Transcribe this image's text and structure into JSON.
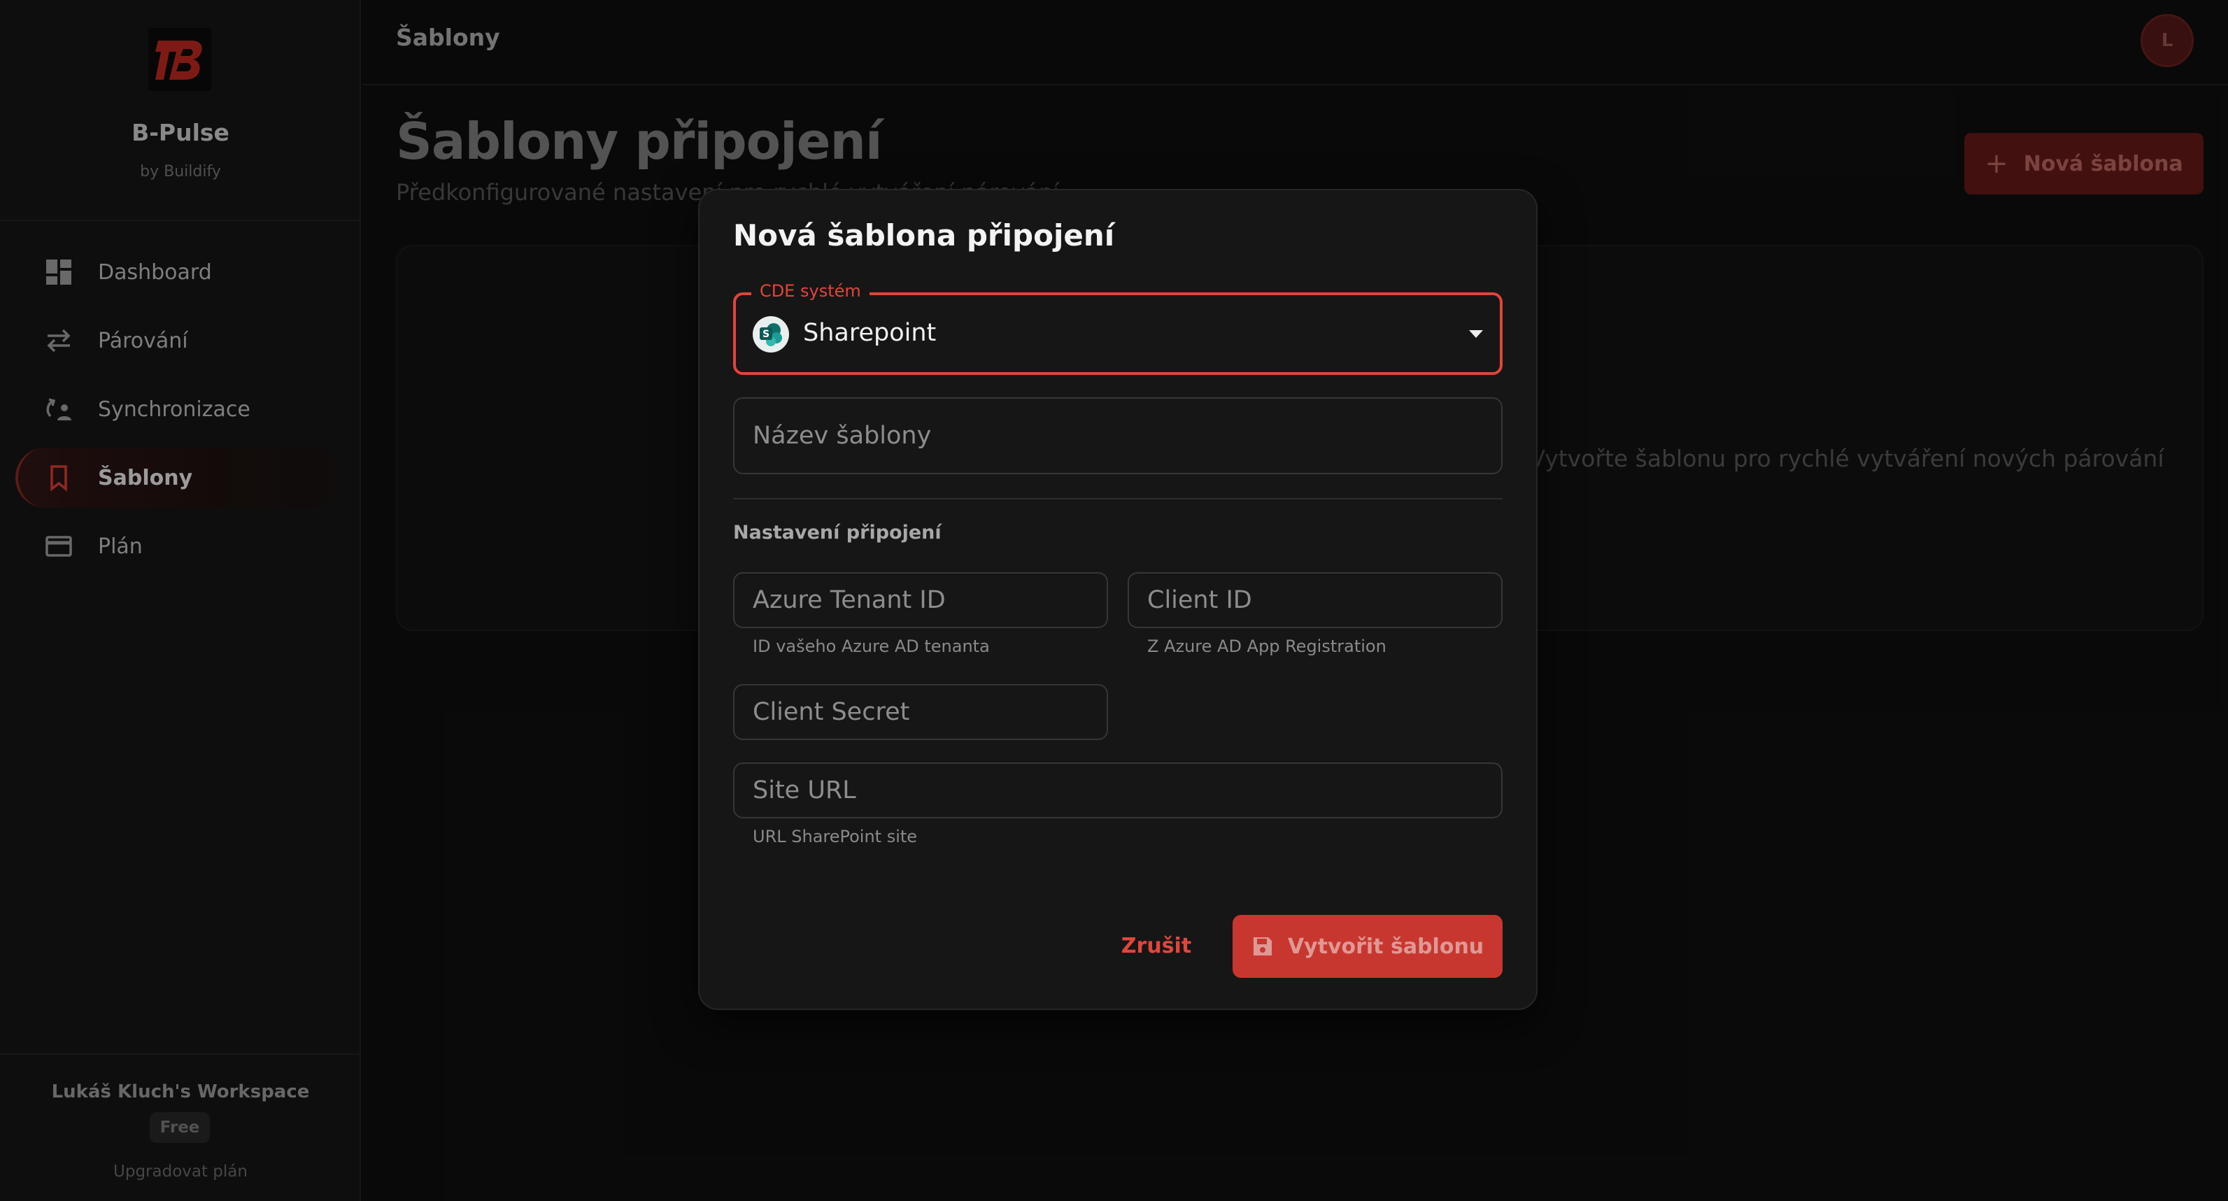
{
  "brand": {
    "logo_text": "B",
    "app_name": "B-Pulse",
    "byline": "by Buildify"
  },
  "sidebar": {
    "items": [
      {
        "label": "Dashboard",
        "icon": "dashboard-icon",
        "active": false
      },
      {
        "label": "Párování",
        "icon": "swap-arrows-icon",
        "active": false
      },
      {
        "label": "Synchronizace",
        "icon": "sync-icon",
        "active": false
      },
      {
        "label": "Šablony",
        "icon": "bookmark-icon",
        "active": true
      },
      {
        "label": "Plán",
        "icon": "credit-card-icon",
        "active": false
      }
    ]
  },
  "workspace": {
    "name": "Lukáš Kluch's Workspace",
    "plan": "Free",
    "upgrade": "Upgradovat plán"
  },
  "topbar": {
    "title": "Šablony",
    "avatar_initial": "L"
  },
  "main": {
    "title": "Šablony připojení",
    "subtitle": "Předkonfigurované nastavení pro rychlé vytváření párování",
    "new_button": "Nová šablona",
    "empty_text": "Vytvořte šablonu pro rychlé vytváření nových párování."
  },
  "modal": {
    "title": "Nová šablona připojení",
    "cde_label": "CDE systém",
    "cde_value": "Sharepoint",
    "name_placeholder": "Název šablony",
    "section_label": "Nastavení připojení",
    "tenant_placeholder": "Azure Tenant ID",
    "tenant_helper": "ID vašeho Azure AD tenanta",
    "client_placeholder": "Client ID",
    "client_helper": "Z Azure AD App Registration",
    "secret_placeholder": "Client Secret",
    "site_placeholder": "Site URL",
    "site_helper": "URL SharePoint site",
    "cancel": "Zrušit",
    "create": "Vytvořit šablonu"
  },
  "colors": {
    "accent": "#d83a32",
    "accent_dark": "#581714",
    "background": "#0d0d0d",
    "sidebar": "#131313",
    "modal": "#161616"
  }
}
